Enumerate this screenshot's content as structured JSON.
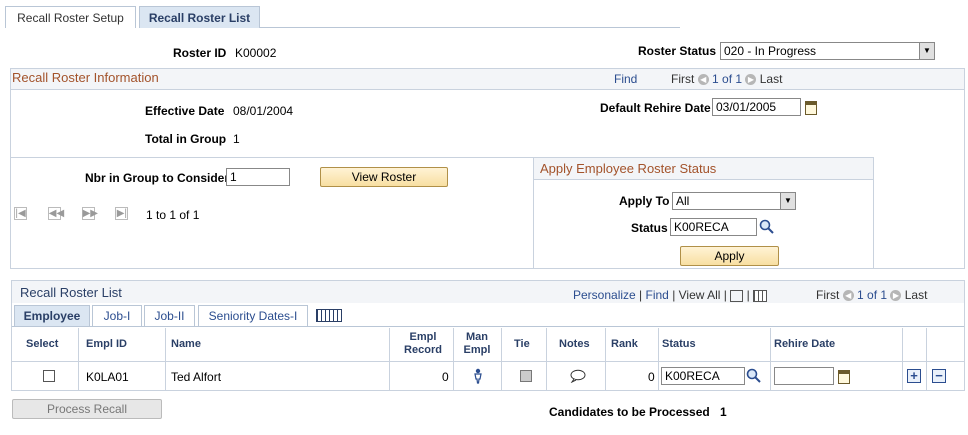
{
  "tabs": [
    {
      "label": "Recall Roster Setup"
    },
    {
      "label": "Recall Roster List"
    }
  ],
  "header": {
    "roster_id_label": "Roster ID",
    "roster_id": "K00002",
    "roster_status_label": "Roster Status",
    "roster_status": "020 - In Progress"
  },
  "info": {
    "title": "Recall Roster Information",
    "find": "Find",
    "first": "First",
    "count": "1 of 1",
    "last": "Last",
    "effective_date_label": "Effective Date",
    "effective_date": "08/01/2004",
    "total_label": "Total in Group",
    "total": "1",
    "rehire_label": "Default Rehire Date",
    "rehire_date": "03/01/2005"
  },
  "consider": {
    "label": "Nbr in Group to Consider",
    "value": "1",
    "view_button": "View Roster",
    "range": "1 to 1 of 1"
  },
  "apply_status": {
    "title": "Apply Employee Roster Status",
    "apply_to_label": "Apply To",
    "apply_to": "All",
    "status_label": "Status",
    "status": "K00RECA",
    "apply_button": "Apply"
  },
  "list": {
    "title": "Recall Roster List",
    "personalize": "Personalize",
    "find": "Find",
    "view_all": "View All",
    "first": "First",
    "count": "1 of 1",
    "last": "Last",
    "subtabs": [
      "Employee",
      "Job-I",
      "Job-II",
      "Seniority Dates-I"
    ],
    "columns": {
      "select": "Select",
      "emplid": "Empl ID",
      "name": "Name",
      "empl_record": "Empl Record",
      "man_empl": "Man Empl",
      "tie": "Tie",
      "notes": "Notes",
      "rank": "Rank",
      "status": "Status",
      "rehire": "Rehire Date"
    },
    "rows": [
      {
        "emplid": "K0LA01",
        "name": "Ted Alfort",
        "empl_record": "0",
        "rank": "0",
        "status": "K00RECA",
        "rehire": ""
      }
    ]
  },
  "footer": {
    "process_button": "Process Recall",
    "candidates_label": "Candidates to be Processed",
    "candidates": "1"
  }
}
